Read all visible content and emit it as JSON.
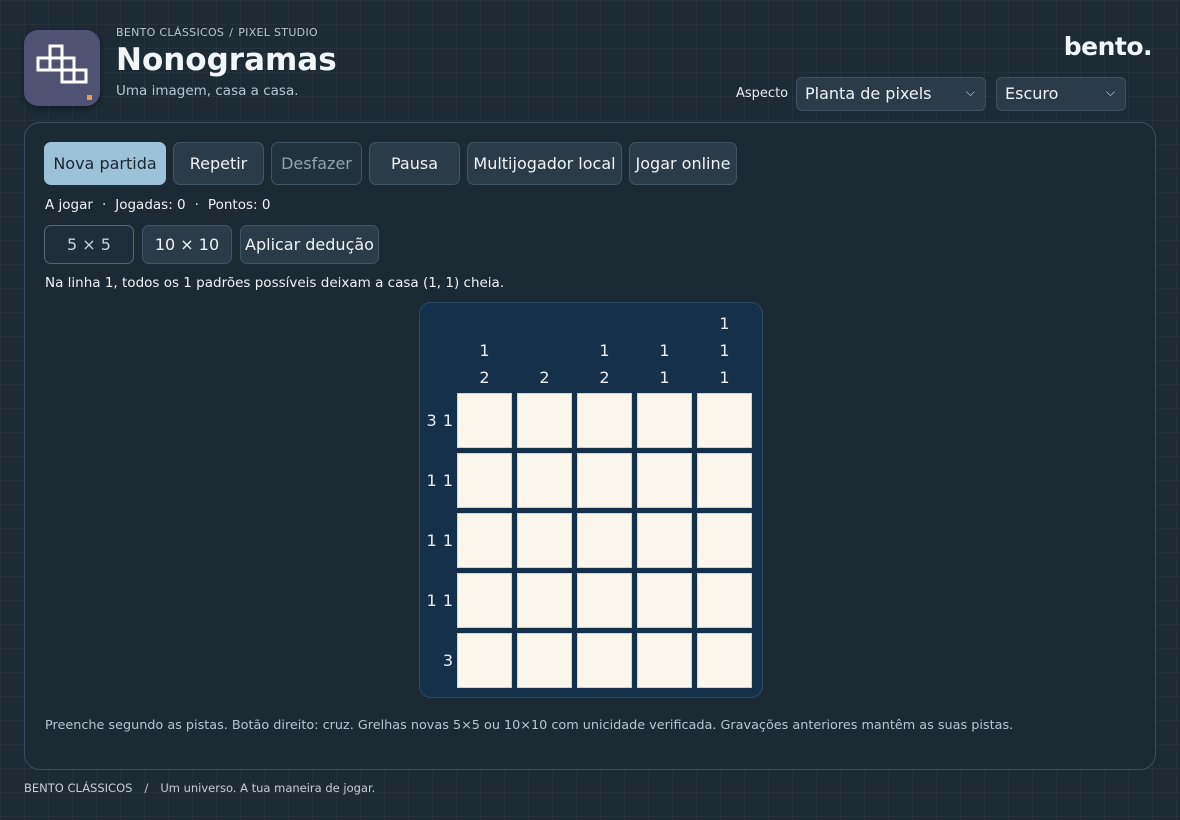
{
  "header": {
    "breadcrumb": [
      "BENTO CLÁSSICOS",
      "PIXEL STUDIO"
    ],
    "breadcrumb_sep": "/",
    "title": "Nonogramas",
    "subtitle": "Uma imagem, casa a casa.",
    "brand": "bento.",
    "aspect_label": "Aspecto",
    "aspect_value": "Planta de pixels",
    "theme_value": "Escuro"
  },
  "toolbar": {
    "new_game": "Nova partida",
    "repeat": "Repetir",
    "undo": "Desfazer",
    "pause": "Pausa",
    "local_multiplayer": "Multijogador local",
    "play_online": "Jogar online"
  },
  "status": {
    "state": "A jogar",
    "moves_label": "Jogadas: 0",
    "points_label": "Pontos: 0",
    "sep": "·"
  },
  "sizes": {
    "five": "5 × 5",
    "ten": "10 × 10",
    "apply": "Aplicar dedução"
  },
  "hint": "Na linha 1, todos os 1 padrões possíveis deixam a casa (1, 1) cheia.",
  "puzzle": {
    "size": 5,
    "column_clues": [
      [
        "1",
        "2"
      ],
      [
        "2"
      ],
      [
        "1",
        "2"
      ],
      [
        "1",
        "1"
      ],
      [
        "1",
        "1",
        "1"
      ]
    ],
    "row_clues": [
      "3 1",
      "1 1",
      "1 1",
      "1 1",
      "3"
    ],
    "cells": [
      [
        0,
        0,
        0,
        0,
        0
      ],
      [
        0,
        0,
        0,
        0,
        0
      ],
      [
        0,
        0,
        0,
        0,
        0
      ],
      [
        0,
        0,
        0,
        0,
        0
      ],
      [
        0,
        0,
        0,
        0,
        0
      ]
    ]
  },
  "footnote": "Preenche segundo as pistas. Botão direito: cruz. Grelhas novas 5×5 ou 10×10 com unicidade verificada. Gravações anteriores mantêm as suas pistas.",
  "footer": {
    "brand": "BENTO CLÁSSICOS",
    "sep": "/",
    "tagline": "Um universo. A tua maneira de jogar."
  },
  "colors": {
    "accent": "#9cc2d9",
    "board": "#15304a",
    "cell_empty": "#faf6ec",
    "logo": "#4f5273"
  },
  "icons": {
    "logo": "pixel-blocks-icon",
    "select_caret": "chevron-down-icon"
  }
}
